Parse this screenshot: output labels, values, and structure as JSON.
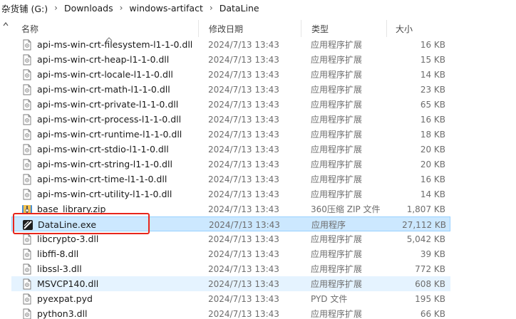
{
  "breadcrumb": [
    "杂货铺 (G:)",
    "Downloads",
    "windows-artifact",
    "DataLine"
  ],
  "columns": {
    "name": "名称",
    "date": "修改日期",
    "type": "类型",
    "size": "大小"
  },
  "colors": {
    "selected_bg": "#cce8ff",
    "selected_border": "#99d1ff",
    "highlight": "#e8261c"
  },
  "files": [
    {
      "name": "api-ms-win-crt-filesystem-l1-1-0.dll",
      "date": "2024/7/13 13:43",
      "type": "应用程序扩展",
      "size": "16 KB",
      "icon": "dll-file-icon"
    },
    {
      "name": "api-ms-win-crt-heap-l1-1-0.dll",
      "date": "2024/7/13 13:43",
      "type": "应用程序扩展",
      "size": "15 KB",
      "icon": "dll-file-icon"
    },
    {
      "name": "api-ms-win-crt-locale-l1-1-0.dll",
      "date": "2024/7/13 13:43",
      "type": "应用程序扩展",
      "size": "14 KB",
      "icon": "dll-file-icon"
    },
    {
      "name": "api-ms-win-crt-math-l1-1-0.dll",
      "date": "2024/7/13 13:43",
      "type": "应用程序扩展",
      "size": "23 KB",
      "icon": "dll-file-icon"
    },
    {
      "name": "api-ms-win-crt-private-l1-1-0.dll",
      "date": "2024/7/13 13:43",
      "type": "应用程序扩展",
      "size": "65 KB",
      "icon": "dll-file-icon"
    },
    {
      "name": "api-ms-win-crt-process-l1-1-0.dll",
      "date": "2024/7/13 13:43",
      "type": "应用程序扩展",
      "size": "16 KB",
      "icon": "dll-file-icon"
    },
    {
      "name": "api-ms-win-crt-runtime-l1-1-0.dll",
      "date": "2024/7/13 13:43",
      "type": "应用程序扩展",
      "size": "18 KB",
      "icon": "dll-file-icon"
    },
    {
      "name": "api-ms-win-crt-stdio-l1-1-0.dll",
      "date": "2024/7/13 13:43",
      "type": "应用程序扩展",
      "size": "20 KB",
      "icon": "dll-file-icon"
    },
    {
      "name": "api-ms-win-crt-string-l1-1-0.dll",
      "date": "2024/7/13 13:43",
      "type": "应用程序扩展",
      "size": "20 KB",
      "icon": "dll-file-icon"
    },
    {
      "name": "api-ms-win-crt-time-l1-1-0.dll",
      "date": "2024/7/13 13:43",
      "type": "应用程序扩展",
      "size": "16 KB",
      "icon": "dll-file-icon"
    },
    {
      "name": "api-ms-win-crt-utility-l1-1-0.dll",
      "date": "2024/7/13 13:43",
      "type": "应用程序扩展",
      "size": "14 KB",
      "icon": "dll-file-icon"
    },
    {
      "name": "base_library.zip",
      "date": "2024/7/13 13:43",
      "type": "360压缩 ZIP 文件",
      "size": "1,807 KB",
      "icon": "zip-archive-icon"
    },
    {
      "name": "DataLine.exe",
      "date": "2024/7/13 13:43",
      "type": "应用程序",
      "size": "27,112 KB",
      "icon": "dataline-app-icon",
      "selected": true
    },
    {
      "name": "libcrypto-3.dll",
      "date": "2024/7/13 13:43",
      "type": "应用程序扩展",
      "size": "5,042 KB",
      "icon": "dll-file-icon"
    },
    {
      "name": "libffi-8.dll",
      "date": "2024/7/13 13:43",
      "type": "应用程序扩展",
      "size": "39 KB",
      "icon": "dll-file-icon"
    },
    {
      "name": "libssl-3.dll",
      "date": "2024/7/13 13:43",
      "type": "应用程序扩展",
      "size": "772 KB",
      "icon": "dll-file-icon"
    },
    {
      "name": "MSVCP140.dll",
      "date": "2024/7/13 13:43",
      "type": "应用程序扩展",
      "size": "608 KB",
      "icon": "dll-file-icon",
      "hovered": true
    },
    {
      "name": "pyexpat.pyd",
      "date": "2024/7/13 13:43",
      "type": "PYD 文件",
      "size": "195 KB",
      "icon": "pyd-file-icon"
    },
    {
      "name": "python3.dll",
      "date": "2024/7/13 13:43",
      "type": "应用程序扩展",
      "size": "66 KB",
      "icon": "dll-file-icon"
    }
  ]
}
